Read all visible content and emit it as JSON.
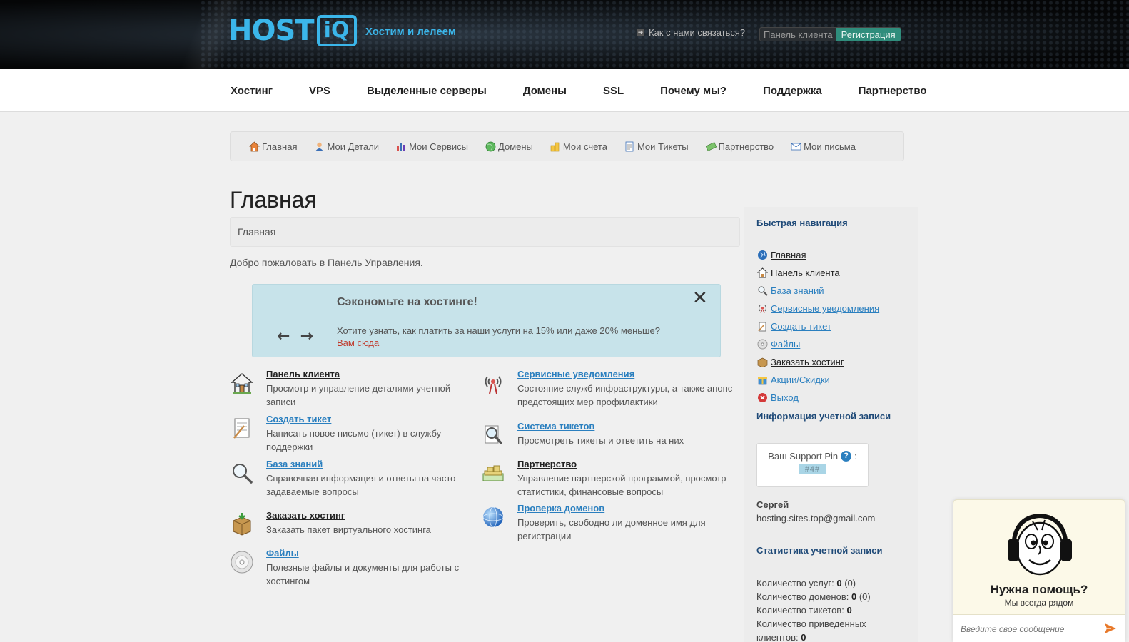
{
  "header": {
    "logo_text": "HOST",
    "logo_box": "iQ",
    "slogan": "Хостим и лелеем",
    "contact": "Как с нами связаться?",
    "panel_label": "Панель клиента",
    "register_label": "Регистрация"
  },
  "mainnav": [
    "Хостинг",
    "VPS",
    "Выделенные серверы",
    "Домены",
    "SSL",
    "Почему мы?",
    "Поддержка",
    "Партнерство"
  ],
  "subnav": [
    "Главная",
    "Мои Детали",
    "Мои Сервисы",
    "Домены",
    "Мои счета",
    "Мои Тикеты",
    "Партнерство",
    "Мои письма"
  ],
  "page": {
    "title": "Главная",
    "breadcrumb": "Главная",
    "welcome": "Добро пожаловать в Панель Управления."
  },
  "promo": {
    "title": "Сэкономьте на хостинге!",
    "text": "Хотите узнать, как платить за наши услуги на 15% или даже 20% меньше?",
    "link": "Вам сюда",
    "close": "✕",
    "prev": "←",
    "next": "→"
  },
  "tiles": [
    {
      "title": "Панель клиента",
      "desc": "Просмотр и управление деталями учетной записи"
    },
    {
      "title": "Сервисные уведомления",
      "desc": "Состояние служб инфраструктуры, а также анонс предстоящих мер профилактики"
    },
    {
      "title": "Создать тикет",
      "desc": "Написать новое письмо (тикет) в службу поддержки"
    },
    {
      "title": "Система тикетов",
      "desc": "Просмотреть тикеты и ответить на них"
    },
    {
      "title": "База знаний",
      "desc": "Справочная информация и ответы на часто задаваемые вопросы"
    },
    {
      "title": "Партнерство",
      "desc": "Управление партнерской программой, просмотр статистики, финансовые вопросы"
    },
    {
      "title": "Заказать хостинг",
      "desc": "Заказать пакет виртуального хостинга"
    },
    {
      "title": "Проверка доменов",
      "desc": "Проверить, свободно ли доменное имя для регистрации"
    },
    {
      "title": "Файлы",
      "desc": "Полезные файлы и документы для работы с хостингом"
    }
  ],
  "sidebar": {
    "quicknav_title": "Быстрая навигация",
    "quicknav": [
      "Главная",
      "Панель клиента",
      "База знаний",
      "Сервисные уведомления",
      "Создать тикет",
      "Файлы",
      "Заказать хостинг",
      "Акции/Скидки",
      "Выход"
    ],
    "account_title": "Информация учетной записи",
    "pin_label": "Ваш Support Pin",
    "pin_colon": ":",
    "pin_help": "?",
    "pin_value": "#4#",
    "user_name": "Сергей",
    "user_email": "hosting.sites.top@gmail.com",
    "stats_title": "Статистика учетной записи",
    "stats": {
      "services_label": "Количество услуг:",
      "services_value": "0",
      "services_extra": "(0)",
      "domains_label": "Количество доменов:",
      "domains_value": "0",
      "domains_extra": "(0)",
      "tickets_label": "Количество тикетов:",
      "tickets_value": "0",
      "referred_label": "Количество приведенных клиентов:",
      "referred_value": "0"
    }
  },
  "chat": {
    "title": "Нужна помощь?",
    "subtitle": "Мы всегда рядом",
    "placeholder": "Введите свое сообщение"
  },
  "colors": {
    "accent": "#3bb6ea",
    "link": "#2a7fbf",
    "register": "#2f8d7c",
    "promo_bg": "#c7e3ea",
    "promo_link": "#c0392b",
    "sidebar_head": "#1f4a78"
  }
}
